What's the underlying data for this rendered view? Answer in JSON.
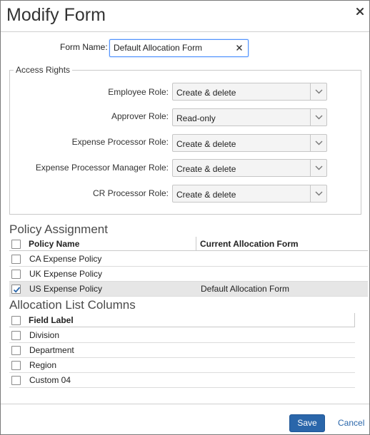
{
  "dialog": {
    "title": "Modify Form"
  },
  "form_name": {
    "label": "Form Name:",
    "value": "Default Allocation Form"
  },
  "access_rights": {
    "legend": "Access Rights",
    "roles": [
      {
        "label": "Employee Role:",
        "value": "Create & delete"
      },
      {
        "label": "Approver Role:",
        "value": "Read-only"
      },
      {
        "label": "Expense Processor Role:",
        "value": "Create & delete"
      },
      {
        "label": "Expense Processor Manager Role:",
        "value": "Create & delete"
      },
      {
        "label": "CR Processor Role:",
        "value": "Create & delete"
      }
    ]
  },
  "policy_assignment": {
    "title": "Policy Assignment",
    "headers": {
      "policy_name": "Policy Name",
      "current_form": "Current Allocation Form"
    },
    "rows": [
      {
        "policy": "CA Expense Policy",
        "form": "",
        "checked": false
      },
      {
        "policy": "UK Expense Policy",
        "form": "",
        "checked": false
      },
      {
        "policy": "US Expense Policy",
        "form": "Default Allocation Form",
        "checked": true
      }
    ]
  },
  "allocation_columns": {
    "title": "Allocation List Columns",
    "header": "Field Label",
    "rows": [
      {
        "label": "Division",
        "checked": false
      },
      {
        "label": "Department",
        "checked": false
      },
      {
        "label": "Region",
        "checked": false
      },
      {
        "label": "Custom 04",
        "checked": false
      }
    ]
  },
  "footer": {
    "save_label": "Save",
    "cancel_label": "Cancel"
  },
  "colors": {
    "accent": "#2a66aa",
    "focus_border": "#4d90fe",
    "selected_row": "#e6e6e6"
  }
}
